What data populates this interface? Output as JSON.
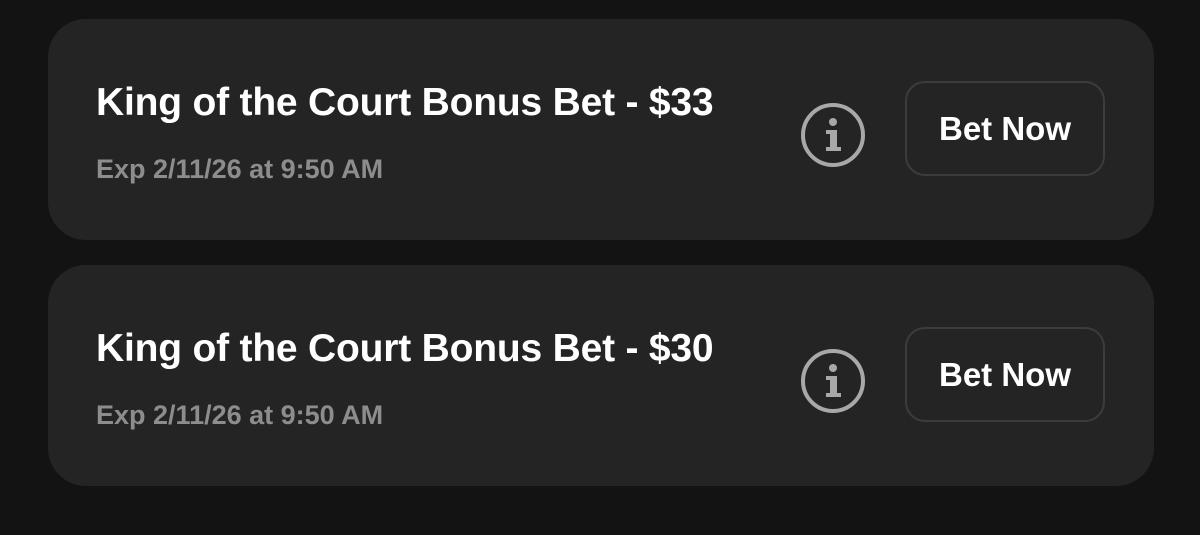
{
  "offers": [
    {
      "title": "King of the Court Bonus Bet - $33",
      "expiry": "Exp 2/11/26 at 9:50 AM",
      "info_icon": "info-icon",
      "button_label": "Bet Now"
    },
    {
      "title": "King of the Court Bonus Bet - $30",
      "expiry": "Exp 2/11/26 at 9:50 AM",
      "info_icon": "info-icon",
      "button_label": "Bet Now"
    }
  ],
  "colors": {
    "page_background": "#131313",
    "card_background": "#242424",
    "title_text": "#ffffff",
    "expiry_text": "#8d8d8d",
    "icon": "#a8a8a8",
    "button_border": "#3c3c3c"
  }
}
